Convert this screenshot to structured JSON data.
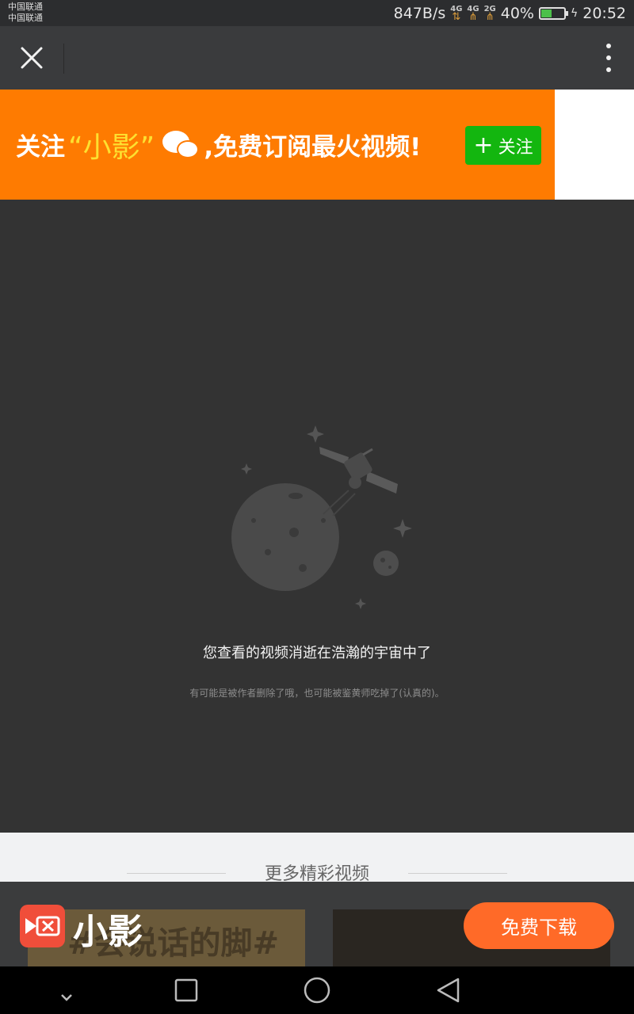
{
  "status_bar": {
    "carrier_1": "中国联通",
    "carrier_2": "中国联通",
    "network_speed": "847B/s",
    "net_1": "4G",
    "net_2": "4G",
    "net_3": "2G",
    "battery_percent": "40%",
    "battery_level": 0.4,
    "time": "20:52"
  },
  "top_bar": {
    "close_icon": "close-icon",
    "more_icon": "more-vertical-icon"
  },
  "banner": {
    "prefix": "关注",
    "app_name": "“小影”",
    "suffix": ",免费订阅最火视频!",
    "follow_button": "关注",
    "bg_color": "#fe7b01",
    "follow_color": "#13b60f"
  },
  "content": {
    "illustration_icon": "planet-satellite-illustration",
    "message": "您查看的视频消逝在浩瀚的宇宙中了",
    "sub_message": "有可能是被作者删除了哦，也可能被鉴黄师吃掉了(认真的)。"
  },
  "more_videos": {
    "title": "更多精彩视频",
    "thumb_1_text": "#会说话的脚#"
  },
  "app_bar": {
    "app_name": "小影",
    "download_button": "免费下载",
    "accent": "#ff6a28"
  }
}
